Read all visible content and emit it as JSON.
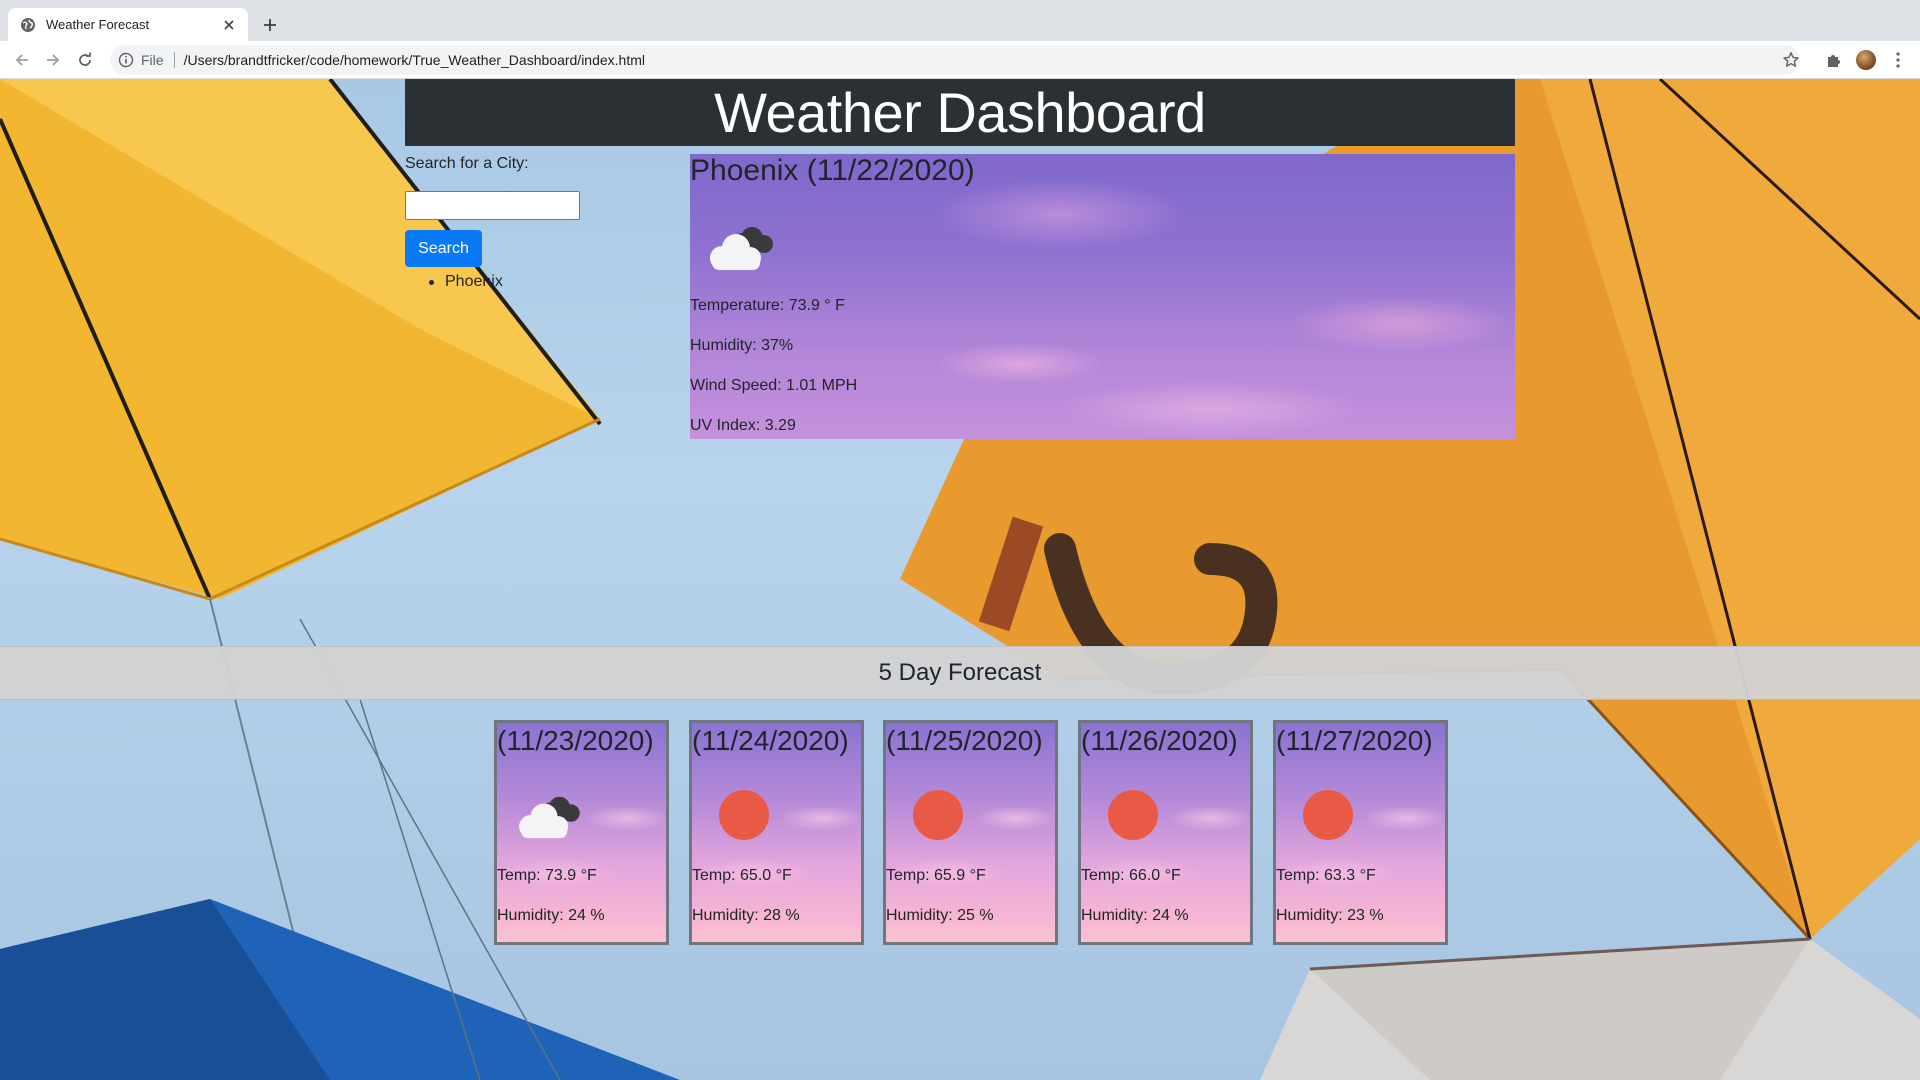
{
  "browser": {
    "tab_title": "Weather Forecast",
    "url_scheme": "File",
    "url": "/Users/brandtfricker/code/homework/True_Weather_Dashboard/index.html"
  },
  "page": {
    "header_title": "Weather Dashboard",
    "search": {
      "label": "Search for a City:",
      "input_value": "",
      "button_label": "Search",
      "history": [
        "Phoenix"
      ]
    },
    "current": {
      "title": "Phoenix (11/22/2020)",
      "icon": "clouds-icon",
      "temperature": "Temperature: 73.9 ° F",
      "humidity": "Humidity: 37%",
      "wind": "Wind Speed: 1.01 MPH",
      "uv": "UV Index: 3.29"
    },
    "forecast_title": "5 Day Forecast",
    "forecast": [
      {
        "date": "(11/23/2020)",
        "icon": "clouds-icon",
        "temp": "Temp: 73.9 °F",
        "humidity": "Humidity: 24 %"
      },
      {
        "date": "(11/24/2020)",
        "icon": "sun-icon",
        "temp": "Temp: 65.0 °F",
        "humidity": "Humidity: 28 %"
      },
      {
        "date": "(11/25/2020)",
        "icon": "sun-icon",
        "temp": "Temp: 65.9 °F",
        "humidity": "Humidity: 25 %"
      },
      {
        "date": "(11/26/2020)",
        "icon": "sun-icon",
        "temp": "Temp: 66.0 °F",
        "humidity": "Humidity: 24 %"
      },
      {
        "date": "(11/27/2020)",
        "icon": "sun-icon",
        "temp": "Temp: 63.3 °F",
        "humidity": "Humidity: 23 %"
      }
    ],
    "colors": {
      "header_bg": "#2b3035",
      "button_bg": "#0a79f5",
      "sun": "#e85a45"
    }
  }
}
